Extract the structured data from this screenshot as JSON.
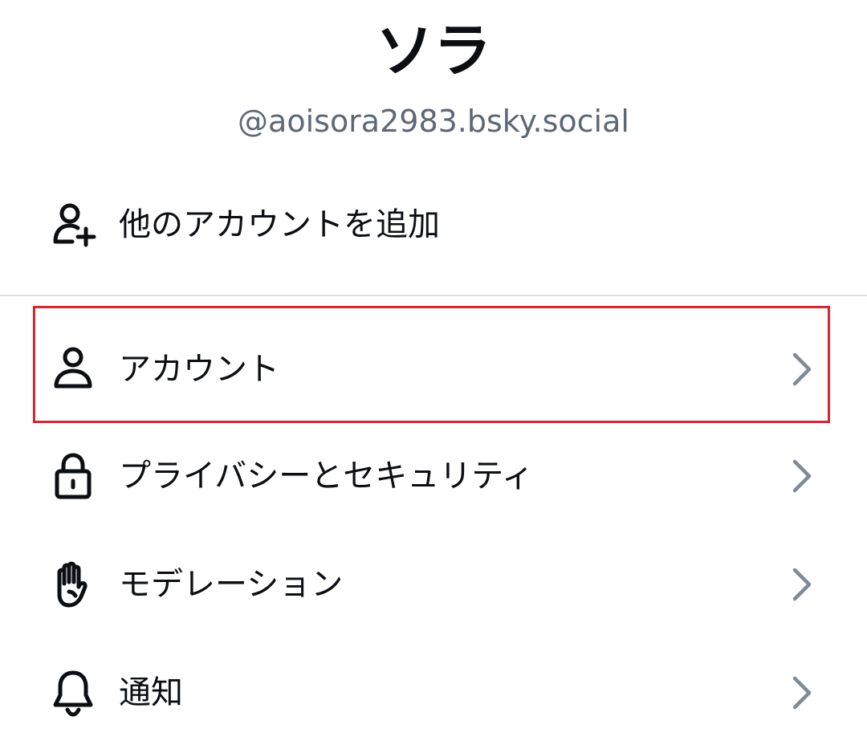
{
  "profile": {
    "display_name": "ソラ",
    "handle": "@aoisora2983.bsky.social"
  },
  "menu": {
    "add_account": {
      "label": "他のアカウントを追加",
      "icon": "user-plus-icon"
    },
    "items": [
      {
        "label": "アカウント",
        "icon": "person-icon",
        "highlighted": true
      },
      {
        "label": "プライバシーとセキュリティ",
        "icon": "lock-icon"
      },
      {
        "label": "モデレーション",
        "icon": "hand-icon"
      },
      {
        "label": "通知",
        "icon": "bell-icon"
      }
    ]
  },
  "colors": {
    "text": "#0b0f14",
    "handle": "#5a6877",
    "chevron": "#7d8a98",
    "divider": "#dfe3e7",
    "highlight_border": "#d6262f"
  }
}
